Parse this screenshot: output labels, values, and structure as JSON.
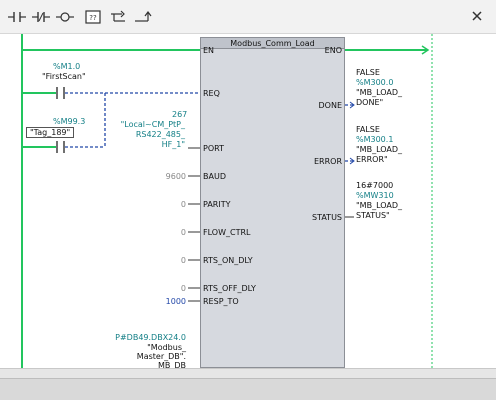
{
  "toolbar": {
    "icons": [
      "normally-open-contact-icon",
      "normally-closed-contact-icon",
      "coil-icon",
      "empty-box-icon",
      "open-branch-icon",
      "close-branch-icon"
    ],
    "box_label": "??"
  },
  "block": {
    "title": "Modbus_Comm_Load",
    "pins_in": {
      "en": "EN",
      "req": "REQ",
      "port": "PORT",
      "baud": "BAUD",
      "parity": "PARITY",
      "flow": "FLOW_CTRL",
      "rts_on": "RTS_ON_DLY",
      "rts_off": "RTS_OFF_DLY",
      "resp": "RESP_TO"
    },
    "pins_out": {
      "eno": "ENO",
      "done": "DONE",
      "error": "ERROR",
      "status": "STATUS"
    }
  },
  "contacts": {
    "first_scan": {
      "address": "%M1.0",
      "name": "\"FirstScan\""
    },
    "tag_189": {
      "address": "%M99.3",
      "name": "\"Tag_189\""
    }
  },
  "inputs": {
    "port": {
      "value": "267",
      "tag_line1": "\"Local~CM_PtP_",
      "tag_line2": "RS422_485_",
      "tag_line3": "HF_1\""
    },
    "baud": "9600",
    "parity": "0",
    "flow": "0",
    "rts_on": "0",
    "rts_off": "0",
    "resp": "1000",
    "mb_db": {
      "address": "P#DB49.DBX24.0",
      "line1": "\"Modbus_",
      "line2": "Master_DB\".",
      "line3": "MB_DB"
    }
  },
  "outputs": {
    "done": {
      "value": "FALSE",
      "address": "%M300.0",
      "line1": "\"MB_LOAD_",
      "line2": "DONE\""
    },
    "error": {
      "value": "FALSE",
      "address": "%M300.1",
      "line1": "\"MB_LOAD_",
      "line2": "ERROR\""
    },
    "status": {
      "value": "16#7000",
      "address": "%MW310",
      "line1": "\"MB_LOAD_",
      "line2": "STATUS\""
    }
  },
  "colors": {
    "power_rail": "#22c55e",
    "block_fill": "#d6d9df",
    "tag_teal": "#137f86",
    "link_blue": "#2247a8"
  }
}
